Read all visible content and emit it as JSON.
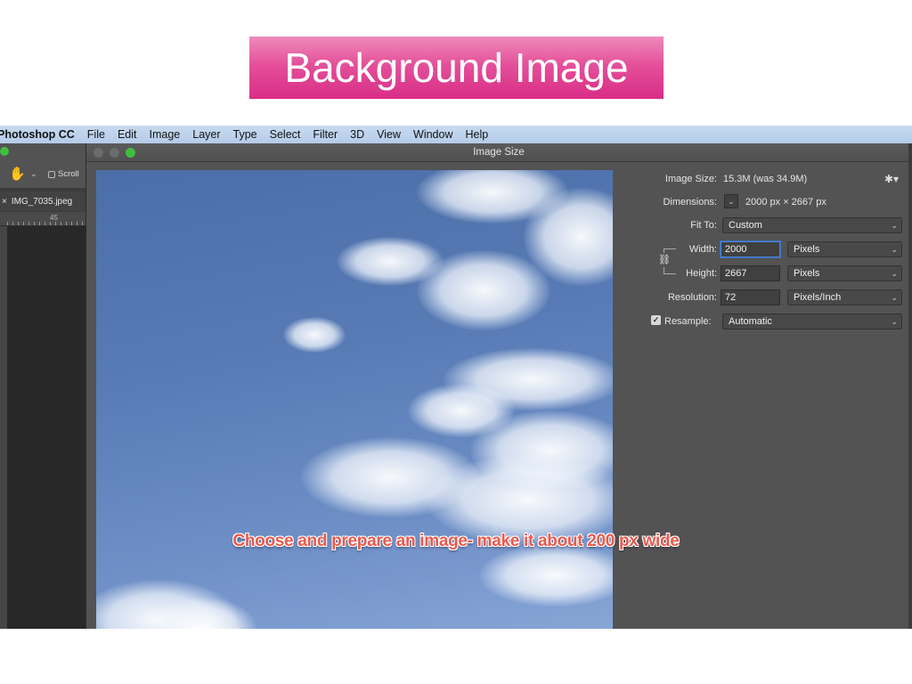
{
  "slide": {
    "title": "Background Image"
  },
  "menubar": {
    "app": "Photoshop CC",
    "items": [
      "File",
      "Edit",
      "Image",
      "Layer",
      "Type",
      "Select",
      "Filter",
      "3D",
      "View",
      "Window",
      "Help"
    ]
  },
  "ps": {
    "toolbar": {
      "scroll_label": "Scroll",
      "hand_icon": "hand-icon"
    },
    "doc_tab": "IMG_7035.jpeg",
    "ruler_mark": "45"
  },
  "dialog": {
    "title": "Image Size",
    "image_size_label": "Image Size:",
    "image_size_value": "15.3M (was 34.9M)",
    "dimensions_label": "Dimensions:",
    "dimensions_value": "2000 px  ×  2667 px",
    "fit_to_label": "Fit To:",
    "fit_to_value": "Custom",
    "width_label": "Width:",
    "width_value": "2000",
    "width_unit": "Pixels",
    "height_label": "Height:",
    "height_value": "2667",
    "height_unit": "Pixels",
    "resolution_label": "Resolution:",
    "resolution_value": "72",
    "resolution_unit": "Pixels/Inch",
    "resample_label": "Resample:",
    "resample_checked": true,
    "resample_value": "Automatic",
    "chevron": "⌄",
    "gear": "✱▾"
  },
  "caption": "Choose and prepare an image- make it about 200 px wide"
}
